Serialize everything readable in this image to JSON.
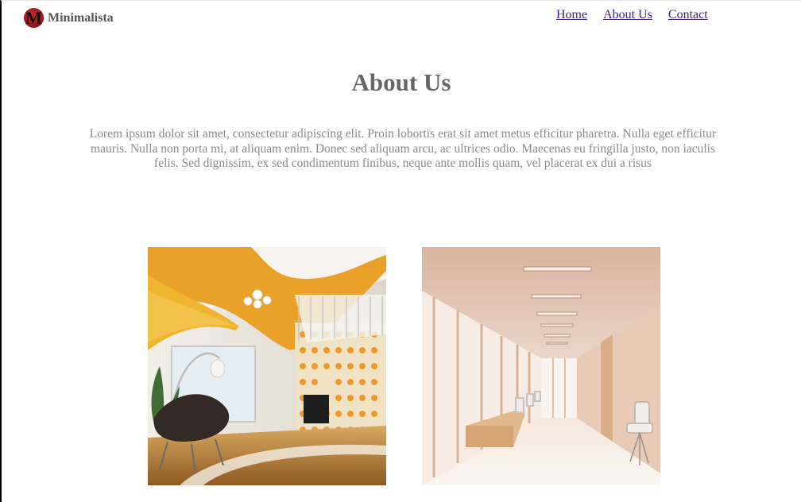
{
  "brand": {
    "logo_letter": "M",
    "name": "Minimalista"
  },
  "nav": {
    "items": [
      {
        "label": "Home"
      },
      {
        "label": "About Us"
      },
      {
        "label": "Contact"
      }
    ]
  },
  "main": {
    "title": "About Us",
    "intro": "Lorem ipsum dolor sit amet, consectetur adipiscing elit. Proin lobortis erat sit amet metus efficitur pharetra. Nulla eget efficitur mauris. Nulla non porta mi, at aliquam enim. Donec sed aliquam arcu, ac ultrices odio. Maecenas eu fringilla justo, non iaculis felis. Sed dignissim, ex sed condimentum finibus, neque ante mollis quam, vel placerat ex dui a risus"
  },
  "colors": {
    "link": "#3c1f7a",
    "heading": "#666666",
    "body_text": "#8a8a8a",
    "logo_accent": "#c0272d"
  }
}
